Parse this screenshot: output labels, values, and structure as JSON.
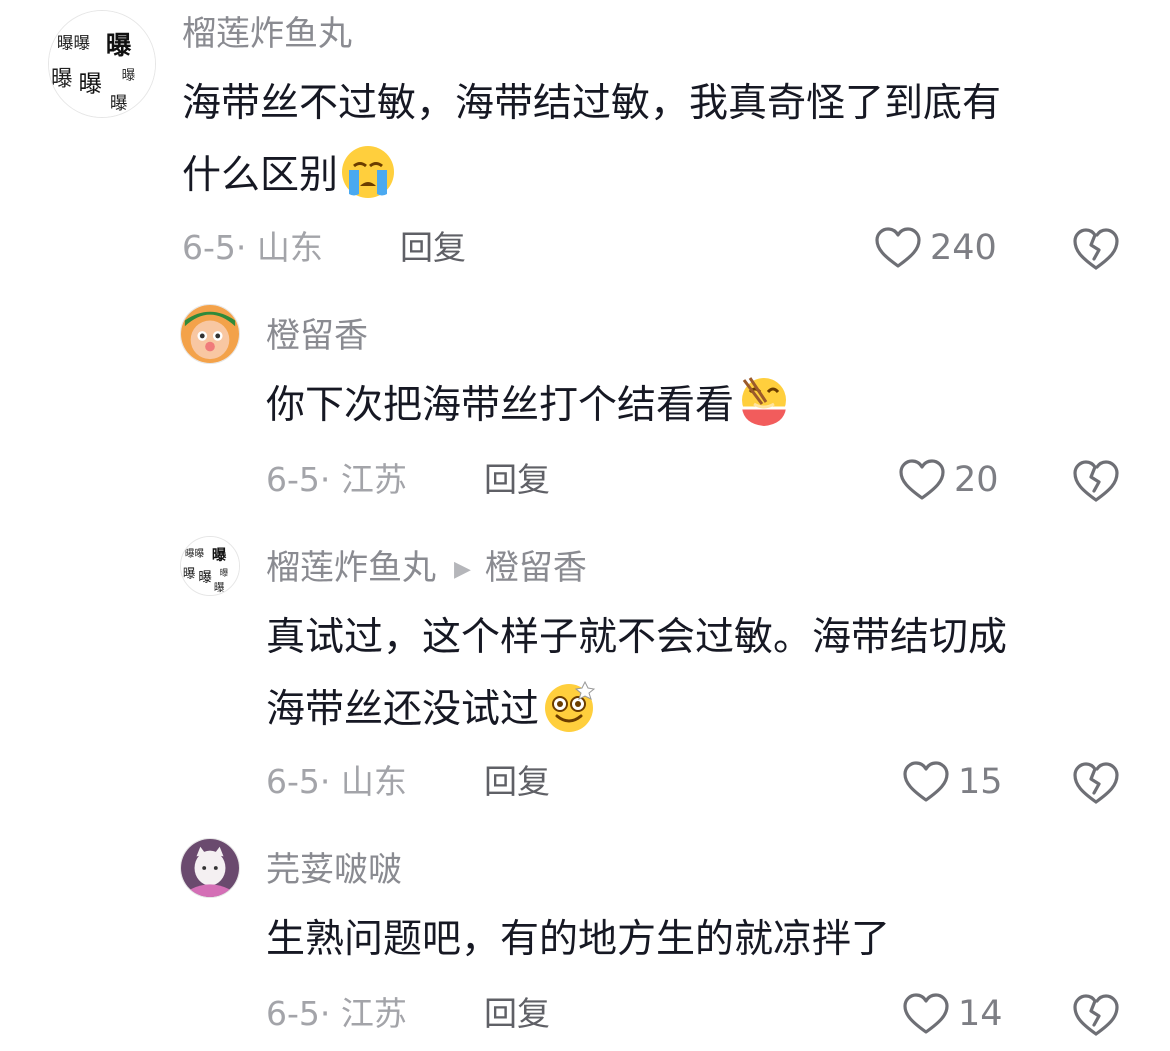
{
  "comments": [
    {
      "author": "榴莲炸鱼丸",
      "text_line1": "海带丝不过敏，海带结过敏，我真奇怪了到底有",
      "text_line2": "什么区别",
      "emoji": "crying-emoji",
      "date_location": "6-5· 山东",
      "reply_label": "回复",
      "likes": "240"
    },
    {
      "author": "橙留香",
      "text_line1": "你下次把海带丝打个结看看",
      "emoji": "eating-noodles-emoji",
      "date_location": "6-5· 江苏",
      "reply_label": "回复",
      "likes": "20"
    },
    {
      "author": "榴莲炸鱼丸",
      "reply_to": "橙留香",
      "text_line1": "真试过，这个样子就不会过敏。海带结切成",
      "text_line2": "海带丝还没试过",
      "emoji": "dizzy-smile-emoji",
      "date_location": "6-5· 山东",
      "reply_label": "回复",
      "likes": "15"
    },
    {
      "author": "芫荽啵啵",
      "text_line1": "生熟问题吧，有的地方生的就凉拌了",
      "date_location": "6-5· 江苏",
      "reply_label": "回复",
      "likes": "14"
    }
  ],
  "colors": {
    "text": "#161823",
    "secondary": "#8a8b91",
    "meta": "#a3a4a9",
    "reply": "#5f6066"
  },
  "icons": {
    "like": "heart-outline-icon",
    "dislike": "broken-heart-icon",
    "reply_arrow": "triangle-right-icon"
  }
}
